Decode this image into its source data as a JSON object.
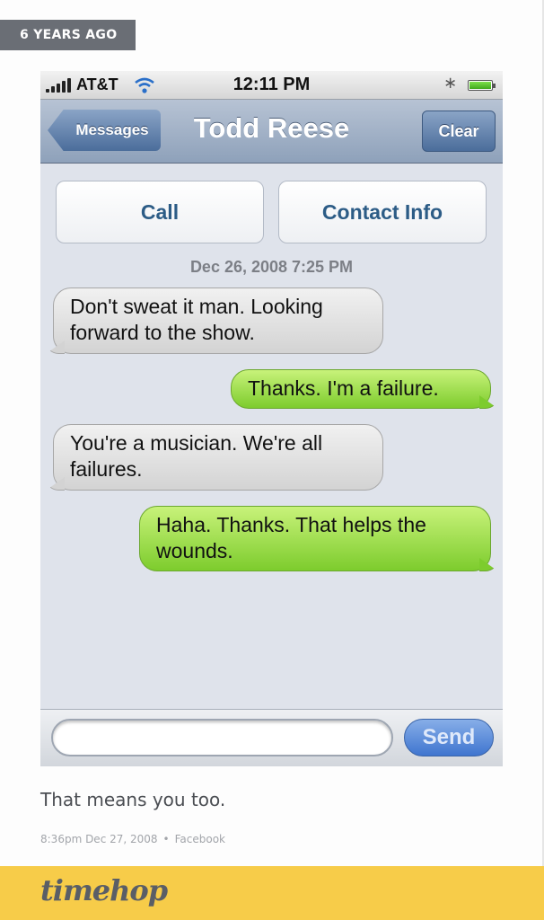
{
  "badge": {
    "label": "6 YEARS AGO"
  },
  "phone": {
    "status": {
      "carrier": "AT&T",
      "time": "12:11 PM",
      "bluetooth_icon": "bluetooth-icon",
      "battery_level": 1.0
    },
    "nav": {
      "back_label": "Messages",
      "title": "Todd Reese",
      "clear_label": "Clear"
    },
    "actions": {
      "call_label": "Call",
      "contact_label": "Contact Info"
    },
    "thread_timestamp": "Dec 26, 2008 7:25 PM",
    "messages": [
      {
        "direction": "in",
        "text": "Don't sweat it man. Looking forward to the show."
      },
      {
        "direction": "out",
        "text": "Thanks. I'm a failure."
      },
      {
        "direction": "in",
        "text": "You're a musician. We're all failures."
      },
      {
        "direction": "out",
        "text": "Haha. Thanks. That helps the wounds."
      }
    ],
    "input": {
      "value": "",
      "send_label": "Send"
    },
    "colors": {
      "incoming": "#d3d3d3",
      "outgoing": "#7dcc2d",
      "nav": "#8ea1ba",
      "send": "#3f75cf"
    }
  },
  "post": {
    "caption": "That means you too.",
    "time": "8:36pm Dec 27, 2008",
    "separator": "•",
    "source": "Facebook"
  },
  "footer": {
    "logo": "timehop",
    "color": "#f7cc49"
  }
}
